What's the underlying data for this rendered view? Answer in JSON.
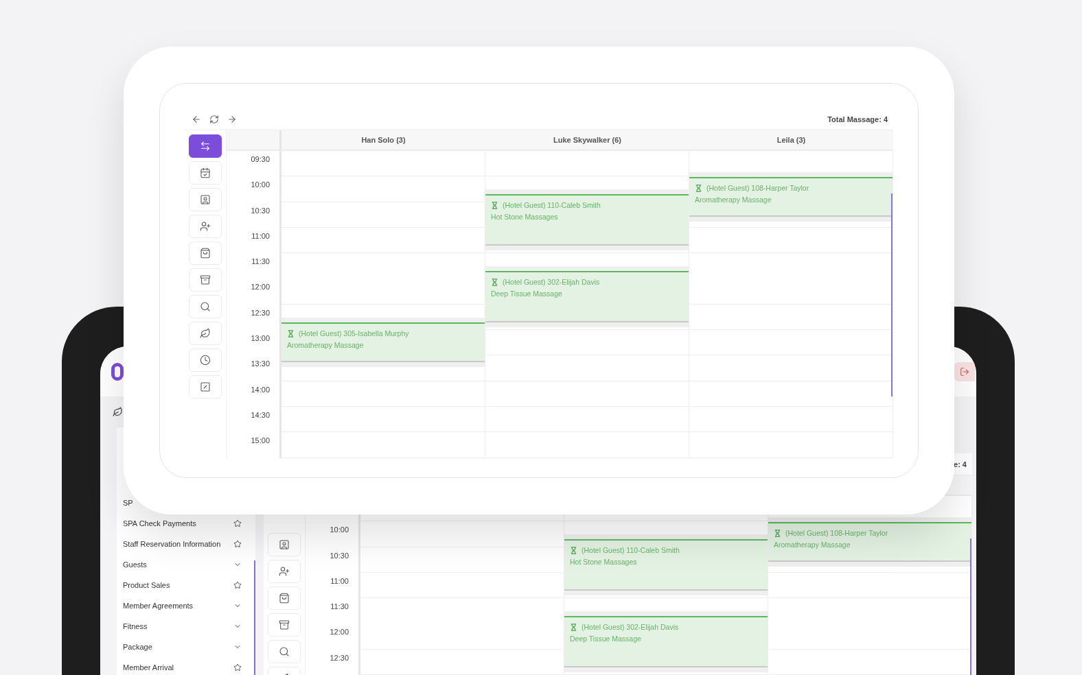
{
  "back": {
    "total": "e: 4",
    "sidebar": [
      {
        "label": "SP",
        "kind": "plain"
      },
      {
        "label": "SPA Check Payments",
        "kind": "star"
      },
      {
        "label": "Staff Reservation Information",
        "kind": "star"
      },
      {
        "label": "Guests",
        "kind": "chevron"
      },
      {
        "label": "Product Sales",
        "kind": "star"
      },
      {
        "label": "Member Agreements",
        "kind": "chevron"
      },
      {
        "label": "Fitness",
        "kind": "chevron"
      },
      {
        "label": "Package",
        "kind": "chevron"
      },
      {
        "label": "Member Arrival",
        "kind": "star"
      }
    ],
    "nav": [
      {
        "kind": "contact",
        "selected": false
      },
      {
        "kind": "user-plus",
        "selected": false
      },
      {
        "kind": "bag",
        "selected": false
      },
      {
        "kind": "archive",
        "selected": false
      },
      {
        "kind": "search",
        "selected": false
      },
      {
        "kind": "leaf",
        "selected": false
      }
    ],
    "times": [
      "10:00",
      "10:30",
      "11:00",
      "11:30",
      "12:00",
      "12:30"
    ],
    "columns": [
      {},
      {
        "events": [
          {
            "guest": "(Hotel Guest) 110-Caleb Smith",
            "service": "Hot Stone Massages"
          },
          {
            "guest": "(Hotel Guest) 302-Elijah Davis",
            "service": "Deep Tissue Massage"
          }
        ]
      },
      {
        "events": [
          {
            "guest": "(Hotel Guest) 108-Harper Taylor",
            "service": "Aromatherapy Massage"
          }
        ]
      }
    ]
  },
  "front": {
    "total": "Total Massage: 4",
    "nav": [
      {
        "kind": "transfer",
        "selected": true
      },
      {
        "kind": "calendar",
        "selected": false
      },
      {
        "kind": "contact",
        "selected": false
      },
      {
        "kind": "user-plus",
        "selected": false
      },
      {
        "kind": "bag",
        "selected": false
      },
      {
        "kind": "archive",
        "selected": false
      },
      {
        "kind": "search",
        "selected": false
      },
      {
        "kind": "leaf",
        "selected": false
      },
      {
        "kind": "clock",
        "selected": false
      },
      {
        "kind": "percent",
        "selected": false
      }
    ],
    "times": [
      "09:30",
      "10:00",
      "10:30",
      "11:00",
      "11:30",
      "12:00",
      "12:30",
      "13:00",
      "13:30",
      "14:00",
      "14:30",
      "15:00"
    ],
    "columns": [
      {
        "name": "Han Solo (3)",
        "events": [
          {
            "guest": "(Hotel Guest) 305-Isabella Murphy",
            "service": "Aromatherapy Massage"
          }
        ]
      },
      {
        "name": "Luke Skywalker (6)",
        "events": [
          {
            "guest": "(Hotel Guest) 110-Caleb Smith",
            "service": "Hot Stone Massages"
          },
          {
            "guest": "(Hotel Guest) 302-Elijah Davis",
            "service": "Deep Tissue Massage"
          }
        ]
      },
      {
        "name": "Leila (3)",
        "events": [
          {
            "guest": "(Hotel Guest) 108-Harper Taylor",
            "service": "Aromatherapy Massage"
          }
        ]
      }
    ]
  }
}
